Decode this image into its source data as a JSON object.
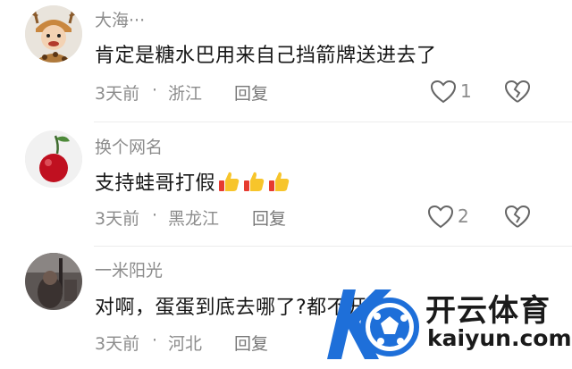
{
  "comments": [
    {
      "username": "大海···",
      "content": "肯定是糖水巴用来自己挡箭牌送进去了",
      "time": "3天前",
      "dot": "·",
      "region": "浙江",
      "reply_label": "回复",
      "like_count": "1",
      "avatar": "toddler-with-antler-hat"
    },
    {
      "username": "换个网名",
      "content": "支持蛙哥打假",
      "emoji": [
        "thumbs-up",
        "thumbs-up",
        "thumbs-up"
      ],
      "time": "3天前",
      "dot": "·",
      "region": "黑龙江",
      "reply_label": "回复",
      "like_count": "2",
      "avatar": "cherry"
    },
    {
      "username": "一米阳光",
      "content": "对啊，蛋蛋到底去哪了?都不开了",
      "time": "3天前",
      "dot": "·",
      "region": "河北",
      "reply_label": "回复",
      "like_count": "",
      "avatar": "dark-photo"
    }
  ],
  "watermark": {
    "text_cn": "开云体育",
    "text_en": "kaiyun.com"
  },
  "colors": {
    "meta_gray": "#8c8c8c",
    "text_dark": "#161616",
    "thumb_yellow": "#f7c52b",
    "thumb_red": "#e63b30",
    "watermark_blue": "#1e6fd9"
  }
}
